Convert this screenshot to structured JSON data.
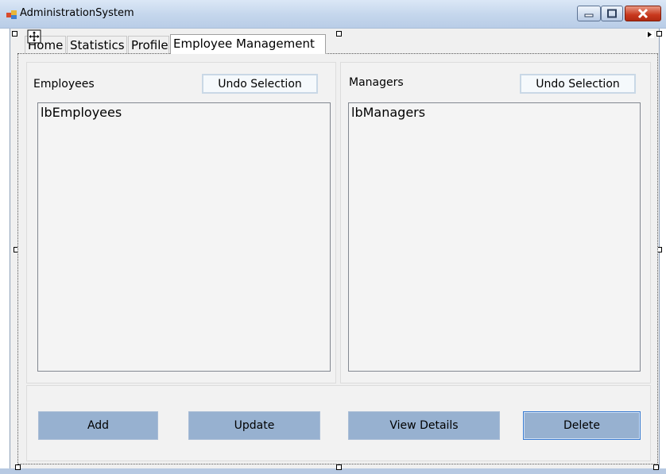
{
  "window": {
    "title": "AdministrationSystem"
  },
  "tabs": [
    {
      "label": "Home"
    },
    {
      "label": "Statistics"
    },
    {
      "label": "Profile"
    },
    {
      "label": "Employee Management",
      "selected": true
    }
  ],
  "employees": {
    "label": "Employees",
    "undo_label": "Undo Selection",
    "listbox_text": "lbEmployees"
  },
  "managers": {
    "label": "Managers",
    "undo_label": "Undo Selection",
    "listbox_text": "lbManagers"
  },
  "actions": {
    "add": "Add",
    "update": "Update",
    "view_details": "View Details",
    "delete": "Delete"
  },
  "colors": {
    "action_button": "#97b1d0",
    "close_button": "#c8381d",
    "focus_border": "#3a7bd0"
  }
}
